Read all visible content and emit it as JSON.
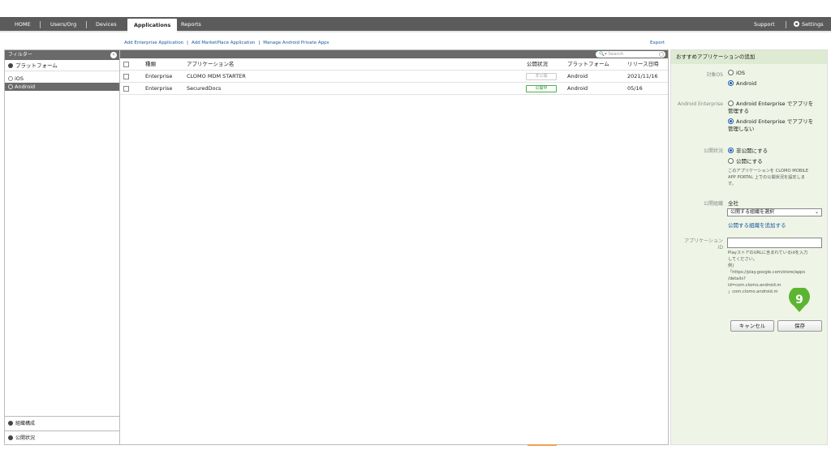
{
  "nav": {
    "home": "HOME",
    "users": "Users/Org",
    "devices": "Devices",
    "applications": "Applications",
    "reports": "Reports",
    "support": "Support",
    "settings": "Settings"
  },
  "actions": {
    "add_enterprise": "Add Enterprise Application",
    "add_marketplace": "Add MarketPlace Application",
    "manage_android": "Manage Android Private Apps",
    "export": "Export"
  },
  "filter": {
    "title": "フィルター",
    "platform_section": "プラットフォーム",
    "options": [
      "iOS",
      "Android"
    ],
    "selected": "Android",
    "org_section": "組織構成",
    "status_section": "公開状況"
  },
  "table": {
    "search_placeholder": "Search",
    "headers": {
      "type": "種類",
      "name": "アプリケーション名",
      "status": "公開状況",
      "platform": "プラットフォーム",
      "release": "リリース日時"
    },
    "rows": [
      {
        "type": "Enterprise",
        "name": "CLOMO MDM STARTER",
        "status": "非公開",
        "platform": "Android",
        "release": "2021/11/16"
      },
      {
        "type": "Enterprise",
        "name": "SecuredDocs",
        "status": "公開中",
        "platform": "Android",
        "release": "05/16"
      }
    ]
  },
  "panel": {
    "title": "おすすめアプリケーションの追加",
    "os_label": "対象OS",
    "os_ios": "iOS",
    "os_android": "Android",
    "ae_label": "Android Enterprise",
    "ae_manage_1": "Android Enterprise でアプリを",
    "ae_manage_2": "管理する",
    "ae_nomanage_1": "Android Enterprise でアプリを",
    "ae_nomanage_2": "管理しない",
    "pub_label": "公開状況",
    "pub_private": "非公開にする",
    "pub_public": "公開にする",
    "pub_note_1": "このアプリケーションを CLOMO MOBILE",
    "pub_note_2": "APP PORTAL 上での公開状況を設定しま",
    "pub_note_3": "す。",
    "org_label": "公開組織",
    "org_value": "全社",
    "org_select": "公開する組織を選択",
    "org_add": "公開する組織を追加する",
    "appid_label_1": "アプリケーション",
    "appid_label_2": "ID",
    "appid_note_1": "PlayストアのURLに含まれているidを入力",
    "appid_note_2": "してください。",
    "appid_note_3": "例)",
    "appid_note_4": "「https://play.google.com/store/apps",
    "appid_note_5": "/details?",
    "appid_note_6": "id=com.clomo.android.m",
    "appid_note_7": "」com.clomo.android.m",
    "cancel": "キャンセル",
    "save": "保存",
    "step": "9"
  },
  "colors": {
    "nav": "#5b5b5b",
    "panel": "#eef5e6",
    "accent": "#5cb531",
    "link": "#1a56a0"
  }
}
